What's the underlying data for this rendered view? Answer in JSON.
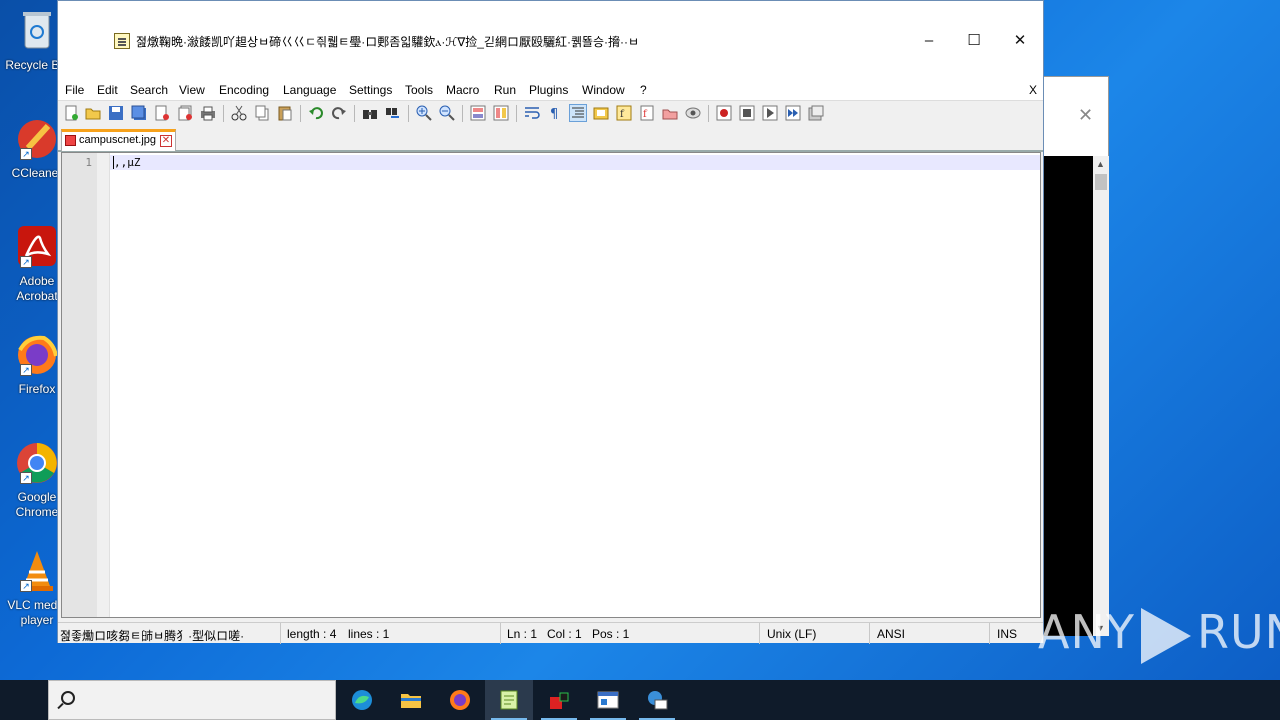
{
  "desktop": {
    "icons": [
      {
        "label": "Recycle Bin",
        "icon": "recycle-bin-icon"
      },
      {
        "label": "CCleaner",
        "icon": "ccleaner-icon"
      },
      {
        "label": "Adobe Acrobat",
        "icon": "adobe-acrobat-icon"
      },
      {
        "label": "Firefox",
        "icon": "firefox-icon"
      },
      {
        "label": "Google Chrome",
        "icon": "chrome-icon"
      },
      {
        "label": "VLC media player",
        "icon": "vlc-icon"
      }
    ]
  },
  "window": {
    "title": "졆燉鞠晩·潊餧凯吖䞡상ㅂ碲巜巜ㄷ즦뤫ㅌ璺·ロ郠좀읿驩欽ⲁ·ℋ∇捡_긷網ロ厭殴驪紅·퀡뚈승·搚··ㅂ",
    "controls": {
      "minimize": "–",
      "maximize": "☐",
      "close": "✕"
    }
  },
  "menu": {
    "items": [
      "File",
      "Edit",
      "Search",
      "View",
      "Encoding",
      "Language",
      "Settings",
      "Tools",
      "Macro",
      "Run",
      "Plugins",
      "Window",
      "?"
    ],
    "close": "X"
  },
  "toolbar": {
    "icons": [
      "new-file-icon",
      "open-file-icon",
      "save-icon",
      "save-all-icon",
      "close-icon",
      "close-all-icon",
      "print-icon",
      "cut-icon",
      "copy-icon",
      "paste-icon",
      "undo-icon",
      "redo-icon",
      "find-icon",
      "replace-icon",
      "zoom-in-icon",
      "zoom-out-icon",
      "sync-v-icon",
      "sync-h-icon",
      "word-wrap-icon",
      "show-all-chars-icon",
      "indent-guide-icon",
      "doc-map-icon",
      "function-list-icon",
      "folder-workspace-icon",
      "doc-list-icon",
      "monitoring-icon",
      "record-macro-icon",
      "stop-macro-icon",
      "play-macro-icon",
      "run-macro-multiple-icon",
      "save-macro-icon"
    ]
  },
  "tab": {
    "label": "campuscnet.jpg",
    "close": "✕"
  },
  "editor": {
    "line_number": "1",
    "line_text": ",,µZ"
  },
  "status": {
    "left_text": "졆좋爋ロ咳芻ㅌ䑔ㅂ腾犭·型似ロ嗟·",
    "length": "length : 4",
    "lines": "lines : 1",
    "ln": "Ln : 1",
    "col": "Col : 1",
    "pos": "Pos : 1",
    "eol": "Unix (LF)",
    "encoding": "ANSI",
    "mode": "INS"
  },
  "taskbar": {
    "apps": [
      "edge-icon",
      "file-explorer-icon",
      "firefox-icon",
      "notepadpp-icon",
      "task-app-icon",
      "window-app-icon",
      "network-app-icon"
    ]
  },
  "watermark": {
    "left": "ANY",
    "right": "RUN"
  }
}
